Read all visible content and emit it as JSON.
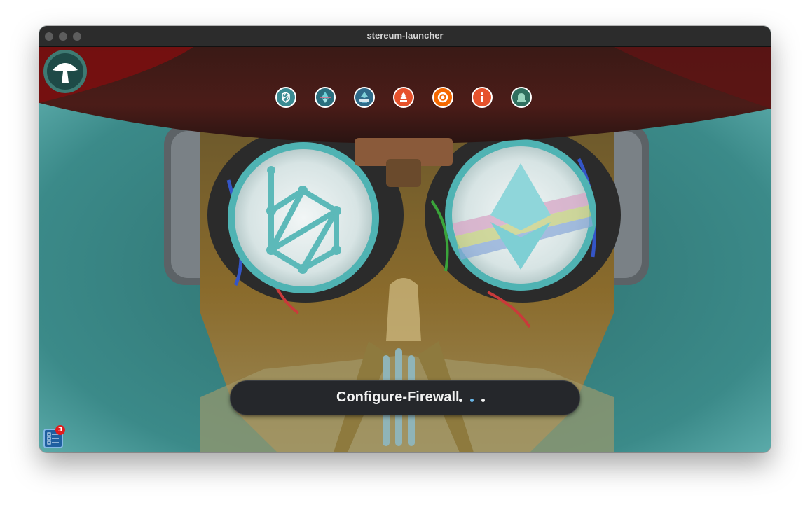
{
  "window": {
    "title": "stereum-launcher"
  },
  "services": [
    {
      "name": "ssv-network-icon",
      "color": "#ffffff"
    },
    {
      "name": "ethereum-icon",
      "color": "#6fd1d8"
    },
    {
      "name": "node-install-icon",
      "color": "#5aa6c4"
    },
    {
      "name": "prometheus-icon",
      "color": "#e6522c"
    },
    {
      "name": "grafana-icon",
      "color": "#f46800"
    },
    {
      "name": "info-icon",
      "color": "#e6522c"
    },
    {
      "name": "notification-bell-icon",
      "color": "#3e8a72"
    }
  ],
  "status": {
    "message": "Configure-Firewall",
    "dot_colors": [
      "#f2f2f2",
      "#6ab7e8",
      "#f2f2f2"
    ]
  },
  "tasks": {
    "badge_count": "3"
  },
  "colors": {
    "header_red": "#7a1010",
    "background_teal": "#3f8f8f",
    "status_bg": "#25272b"
  }
}
